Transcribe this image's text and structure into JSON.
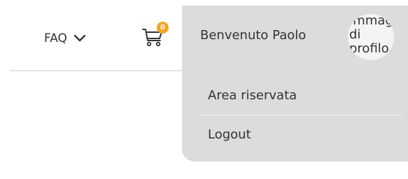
{
  "header": {
    "faq_label": "FAQ",
    "cart": {
      "badge_count": "0"
    }
  },
  "user_menu": {
    "welcome": "Benvenuto Paolo",
    "avatar_alt_text": "Immagine di profilo",
    "items": [
      {
        "label": "Area riservata"
      },
      {
        "label": "Logout"
      }
    ]
  },
  "colors": {
    "badge": "#f2a628",
    "dropdown_bg": "#dcdcdc",
    "text": "#333333"
  }
}
